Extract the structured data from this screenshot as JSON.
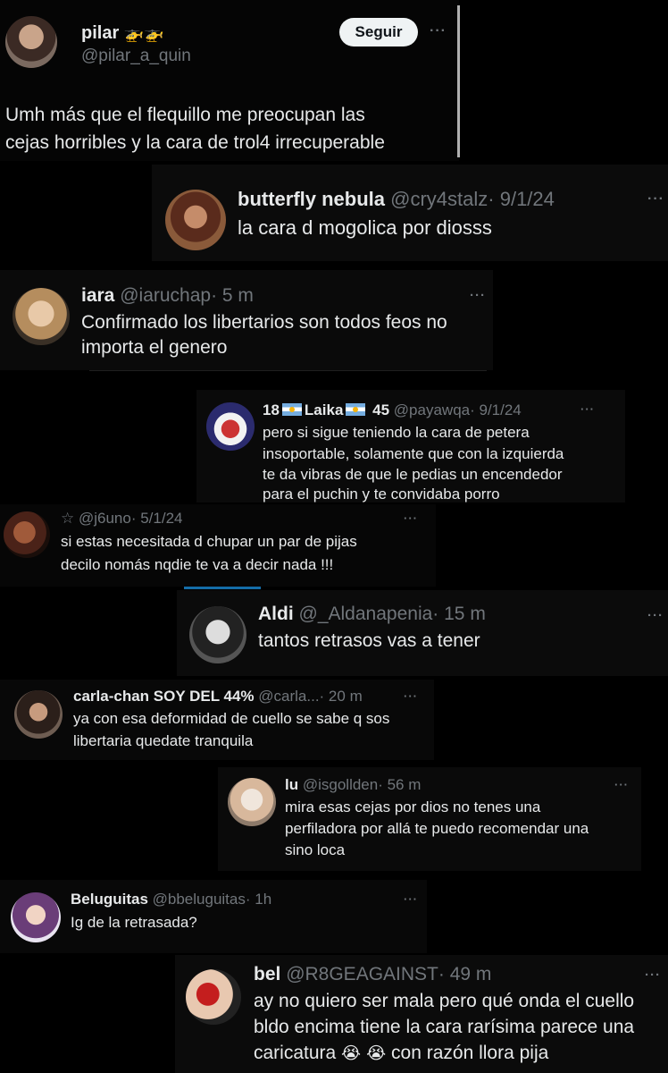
{
  "main_post": {
    "name": "pilar",
    "name_emoji": "🚁🚁",
    "handle": "@pilar_a_quin",
    "follow_label": "Seguir",
    "text_line1": "Umh más que el flequillo me preocupan las",
    "text_line2": "cejas horribles y la cara de trol4 irrecuperable"
  },
  "replies": [
    {
      "name": "butterfly nebula",
      "handle": "@cry4stalz",
      "time": "· 9/1/24",
      "lines": [
        "la cara d mogolica por diosss"
      ]
    },
    {
      "name": "iara",
      "handle": "@iaruchap",
      "time": "· 5 m",
      "lines": [
        "Confirmado los libertarios son todos feos no",
        "importa el genero"
      ]
    },
    {
      "name_pre": "18",
      "name_mid": "Laika",
      "name_post": "45",
      "handle": "@payawqa",
      "time": "· 9/1/24",
      "lines": [
        "pero si sigue teniendo la cara de petera",
        "insoportable, solamente que con la izquierda",
        "te da vibras de que le pedias un encendedor",
        "para el puchin y te convidaba porro"
      ]
    },
    {
      "name": "☆",
      "handle": "@j6uno",
      "time": "· 5/1/24",
      "lines": [
        "si estas necesitada d chupar un par de pijas",
        "decilo nomás nqdie te va a decir nada !!!"
      ]
    },
    {
      "name": "Aldi",
      "handle": "@_Aldanapenia",
      "time": "· 15 m",
      "lines": [
        "tantos retrasos vas a tener"
      ]
    },
    {
      "name": "carla-chan SOY DEL 44%",
      "handle": "@carla...",
      "time": "· 20 m",
      "lines": [
        "ya con esa deformidad de cuello se sabe q sos",
        "libertaria quedate tranquila"
      ]
    },
    {
      "name": "lu",
      "handle": "@isgollden",
      "time": "· 56 m",
      "lines": [
        "mira esas cejas por dios no tenes una",
        "perfiladora por allá te puedo recomendar una",
        "sino loca"
      ]
    },
    {
      "name": "Beluguitas",
      "handle": "@bbeluguitas",
      "time": "· 1h",
      "lines": [
        "Ig de la retrasada?"
      ]
    },
    {
      "name": "bel",
      "handle": "@R8GEAGAINST",
      "time": "· 49 m",
      "lines": [
        "ay no quiero ser mala pero qué onda el cuello",
        "bldo encima tiene la cara rarísima parece una",
        "caricatura"
      ],
      "line3_suffix": "con razón llora pija",
      "emoji": "😭 😭"
    }
  ],
  "icons": {
    "more": "more-options-icon",
    "helicopter": "helicopter-icon",
    "flag": "argentina-flag-icon",
    "crying": "crying-face-icon"
  },
  "colors": {
    "background": "#000000",
    "text": "#e7e9ea",
    "muted": "#71767b",
    "follow_bg": "#eff3f4",
    "accent": "#1d9bf0"
  }
}
